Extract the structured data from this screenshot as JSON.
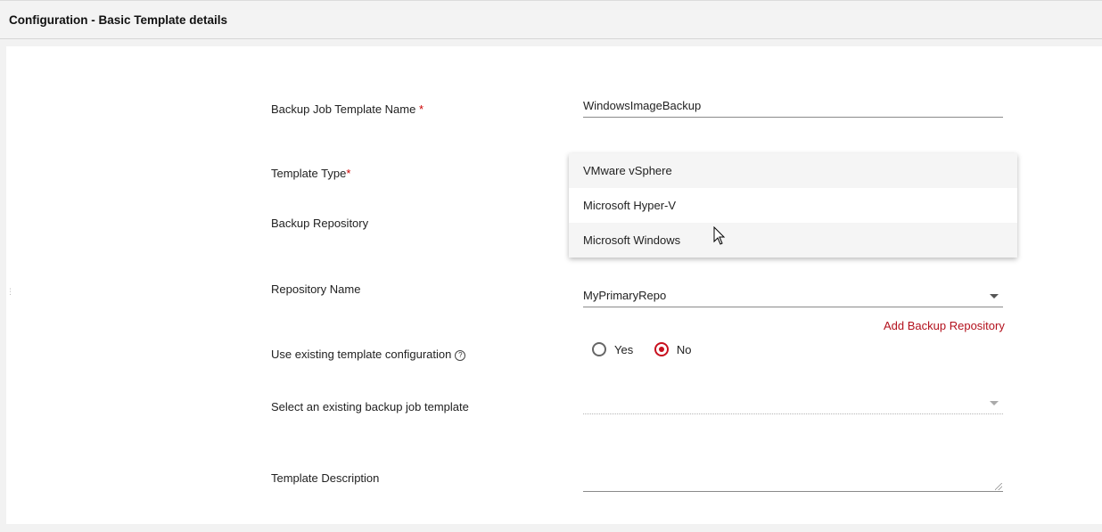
{
  "header": {
    "title": "Configuration - Basic Template details"
  },
  "form": {
    "template_name": {
      "label": "Backup Job Template Name",
      "required_mark": "*",
      "value": "WindowsImageBackup"
    },
    "template_type": {
      "label": "Template Type",
      "required_mark": "*"
    },
    "backup_repository": {
      "label": "Backup Repository"
    },
    "repository_name": {
      "label": "Repository Name",
      "value": "MyPrimaryRepo",
      "add_link": "Add Backup Repository"
    },
    "use_existing": {
      "label": "Use existing template configuration",
      "help_icon": "?",
      "options": [
        "Yes",
        "No"
      ],
      "selected": "No"
    },
    "existing_template": {
      "label": "Select an existing backup job template",
      "value": ""
    },
    "description": {
      "label": "Template Description",
      "value": ""
    }
  },
  "dropdown": {
    "options": [
      "VMware vSphere",
      "Microsoft Hyper-V",
      "Microsoft Windows"
    ],
    "hovered": "Microsoft Windows"
  },
  "colors": {
    "accent": "#c8101e",
    "link": "#b3111d"
  }
}
